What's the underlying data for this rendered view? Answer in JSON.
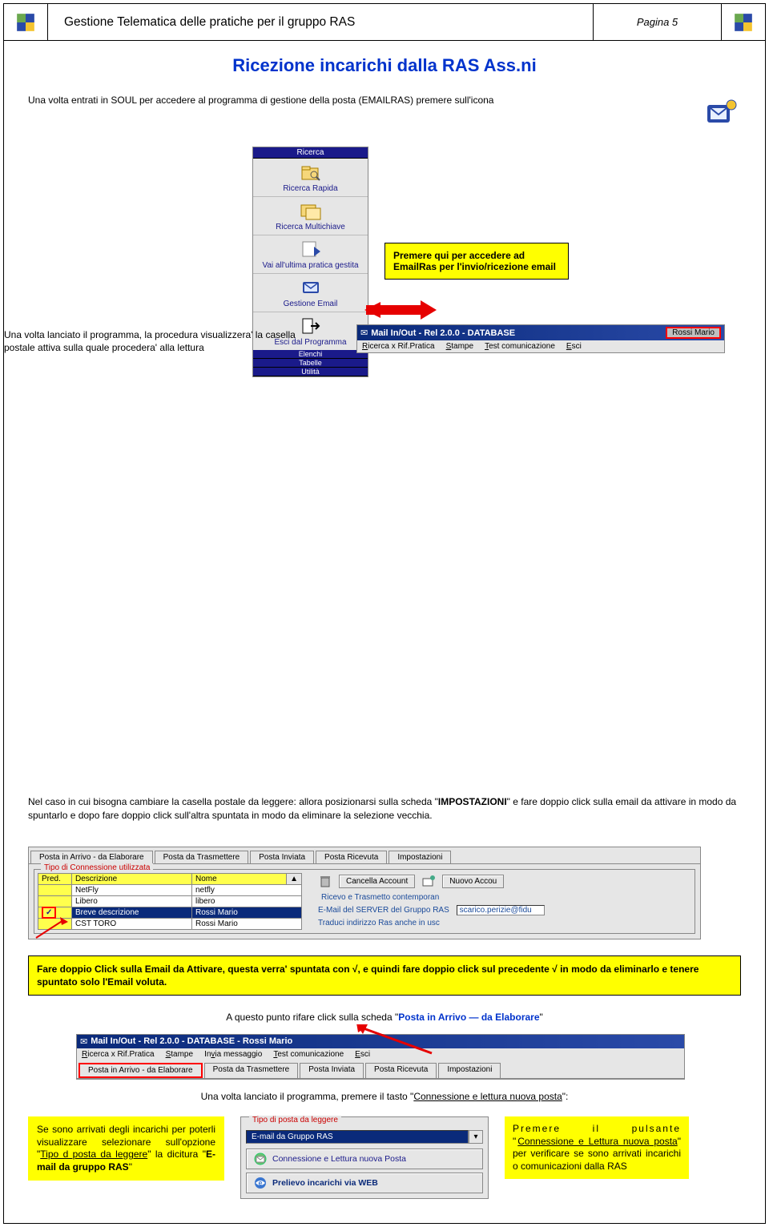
{
  "header": {
    "title": "Gestione Telematica delle pratiche per il gruppo RAS",
    "page": "Pagina 5"
  },
  "mainTitle": "Ricezione incarichi dalla RAS Ass.ni",
  "intro": "Una volta entrati in SOUL per accedere al programma di gestione della posta (EMAILRAS) premere sull'icona",
  "toolbar": {
    "ricerca_bar": "Ricerca",
    "ricerca_rapida": "Ricerca Rapida",
    "ricerca_multi": "Ricerca Multichiave",
    "vai_ultima": "Vai all'ultima pratica gestita",
    "gestione_email": "Gestione Email",
    "esci": "Esci dal Programma",
    "elenchi": "Elenchi",
    "tabelle": "Tabelle",
    "utilita": "Utilità"
  },
  "note1": "Premere qui per accedere ad EmailRas per l'invio/ricezione email",
  "paraLettura": "Una volta lanciato il programma, la procedura visualizzera' la casella postale attiva sulla quale procedera' alla lettura",
  "dbBar": {
    "title": "Mail In/Out - Rel 2.0.0 - DATABASE",
    "user": "Rossi Mario",
    "menu": [
      "Ricerca x Rif.Pratica",
      "Stampe",
      "Test comunicazione",
      "Esci"
    ]
  },
  "bodyPara": {
    "pre": "Nel caso in cui bisogna cambiare la casella postale da leggere: allora posizionarsi sulla scheda \"",
    "word": "IMPOSTAZIONI",
    "post": "\" e fare doppio click sulla email da attivare in modo da spuntarlo e dopo fare doppio click sull'altra spuntata in modo da eliminare la selezione vecchia."
  },
  "settings": {
    "tabs": [
      "Posta in Arrivo - da Elaborare",
      "Posta da Trasmettere",
      "Posta Inviata",
      "Posta Ricevuta",
      "Impostazioni"
    ],
    "legend": "Tipo di Connessione utilizzata",
    "headers": {
      "pred": "Pred.",
      "desc": "Descrizione",
      "nome": "Nome"
    },
    "rows": [
      {
        "pred": "",
        "desc": "NetFly",
        "nome": "netfly"
      },
      {
        "pred": "",
        "desc": "Libero",
        "nome": "libero"
      },
      {
        "pred": "✓",
        "desc": "Breve descrizione",
        "nome": "Rossi Mario",
        "selected": true
      },
      {
        "pred": "",
        "desc": "CST TORO",
        "nome": "Rossi Mario"
      }
    ],
    "cancella": "Cancella Account",
    "nuovo": "Nuovo Accou",
    "rt": "Ricevo e Trasmetto contemporan",
    "server_lbl": "E-Mail del SERVER del Gruppo RAS",
    "server_val": "scarico.perizie@fidu",
    "traduci": "Traduci indirizzo Ras anche in usc"
  },
  "yellowBanner": "Fare doppio Click sulla Email da Attivare, questa verra' spuntata con √, e quindi fare doppio click sul precedente √ in modo da eliminarlo e tenere spuntato solo l'Email voluta.",
  "centeredInstr": {
    "pre": "A questo punto rifare click sulla scheda \"",
    "tab": "Posta in Arrivo — da Elaborare",
    "post": "\""
  },
  "titlebar2": {
    "title": "Mail In/Out - Rel 2.0.0 - DATABASE - Rossi Mario",
    "menu": [
      "Ricerca x Rif.Pratica",
      "Stampe",
      "Invia messaggio",
      "Test comunicazione",
      "Esci"
    ],
    "tabs": [
      "Posta in Arrivo - da Elaborare",
      "Posta da Trasmettere",
      "Posta Inviata",
      "Posta Ricevuta",
      "Impostazioni"
    ]
  },
  "afterTabs": {
    "pre": "Una volta lanciato il programma, premere il tasto \"",
    "link": "Connessione e lettura nuova posta",
    "post": "\":"
  },
  "bottomLeft": {
    "t1": "Se sono arrivati degli incarichi per poterli visualizzare selezionare sull'opzione \"",
    "u1": "Tipo d posta da leggere",
    "t2": "\" la dicitura \"",
    "b1": "E-mail da gruppo RAS",
    "t3": "\""
  },
  "tipoPanel": {
    "legend": "Tipo di posta da leggere",
    "combo": "E-mail da Gruppo RAS",
    "btn1": "Connessione e Lettura nuova Posta",
    "btn2": "Prelievo incarichi via WEB"
  },
  "bottomRight": {
    "t1": "Premere il pulsante \"",
    "u1": "Connessione e Lettura nuova posta",
    "t2": "\" per verificare se sono arrivati incarichi o comunicazioni dalla RAS"
  }
}
